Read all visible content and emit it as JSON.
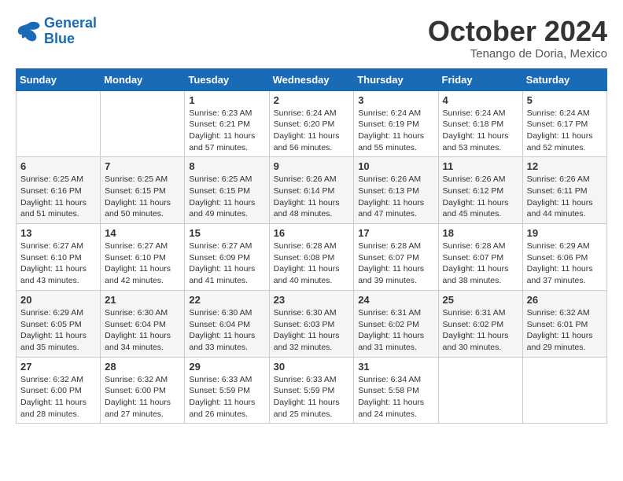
{
  "logo": {
    "line1": "General",
    "line2": "Blue"
  },
  "title": "October 2024",
  "subtitle": "Tenango de Doria, Mexico",
  "days_of_week": [
    "Sunday",
    "Monday",
    "Tuesday",
    "Wednesday",
    "Thursday",
    "Friday",
    "Saturday"
  ],
  "weeks": [
    [
      {
        "num": "",
        "info": ""
      },
      {
        "num": "",
        "info": ""
      },
      {
        "num": "1",
        "info": "Sunrise: 6:23 AM\nSunset: 6:21 PM\nDaylight: 11 hours and 57 minutes."
      },
      {
        "num": "2",
        "info": "Sunrise: 6:24 AM\nSunset: 6:20 PM\nDaylight: 11 hours and 56 minutes."
      },
      {
        "num": "3",
        "info": "Sunrise: 6:24 AM\nSunset: 6:19 PM\nDaylight: 11 hours and 55 minutes."
      },
      {
        "num": "4",
        "info": "Sunrise: 6:24 AM\nSunset: 6:18 PM\nDaylight: 11 hours and 53 minutes."
      },
      {
        "num": "5",
        "info": "Sunrise: 6:24 AM\nSunset: 6:17 PM\nDaylight: 11 hours and 52 minutes."
      }
    ],
    [
      {
        "num": "6",
        "info": "Sunrise: 6:25 AM\nSunset: 6:16 PM\nDaylight: 11 hours and 51 minutes."
      },
      {
        "num": "7",
        "info": "Sunrise: 6:25 AM\nSunset: 6:15 PM\nDaylight: 11 hours and 50 minutes."
      },
      {
        "num": "8",
        "info": "Sunrise: 6:25 AM\nSunset: 6:15 PM\nDaylight: 11 hours and 49 minutes."
      },
      {
        "num": "9",
        "info": "Sunrise: 6:26 AM\nSunset: 6:14 PM\nDaylight: 11 hours and 48 minutes."
      },
      {
        "num": "10",
        "info": "Sunrise: 6:26 AM\nSunset: 6:13 PM\nDaylight: 11 hours and 47 minutes."
      },
      {
        "num": "11",
        "info": "Sunrise: 6:26 AM\nSunset: 6:12 PM\nDaylight: 11 hours and 45 minutes."
      },
      {
        "num": "12",
        "info": "Sunrise: 6:26 AM\nSunset: 6:11 PM\nDaylight: 11 hours and 44 minutes."
      }
    ],
    [
      {
        "num": "13",
        "info": "Sunrise: 6:27 AM\nSunset: 6:10 PM\nDaylight: 11 hours and 43 minutes."
      },
      {
        "num": "14",
        "info": "Sunrise: 6:27 AM\nSunset: 6:10 PM\nDaylight: 11 hours and 42 minutes."
      },
      {
        "num": "15",
        "info": "Sunrise: 6:27 AM\nSunset: 6:09 PM\nDaylight: 11 hours and 41 minutes."
      },
      {
        "num": "16",
        "info": "Sunrise: 6:28 AM\nSunset: 6:08 PM\nDaylight: 11 hours and 40 minutes."
      },
      {
        "num": "17",
        "info": "Sunrise: 6:28 AM\nSunset: 6:07 PM\nDaylight: 11 hours and 39 minutes."
      },
      {
        "num": "18",
        "info": "Sunrise: 6:28 AM\nSunset: 6:07 PM\nDaylight: 11 hours and 38 minutes."
      },
      {
        "num": "19",
        "info": "Sunrise: 6:29 AM\nSunset: 6:06 PM\nDaylight: 11 hours and 37 minutes."
      }
    ],
    [
      {
        "num": "20",
        "info": "Sunrise: 6:29 AM\nSunset: 6:05 PM\nDaylight: 11 hours and 35 minutes."
      },
      {
        "num": "21",
        "info": "Sunrise: 6:30 AM\nSunset: 6:04 PM\nDaylight: 11 hours and 34 minutes."
      },
      {
        "num": "22",
        "info": "Sunrise: 6:30 AM\nSunset: 6:04 PM\nDaylight: 11 hours and 33 minutes."
      },
      {
        "num": "23",
        "info": "Sunrise: 6:30 AM\nSunset: 6:03 PM\nDaylight: 11 hours and 32 minutes."
      },
      {
        "num": "24",
        "info": "Sunrise: 6:31 AM\nSunset: 6:02 PM\nDaylight: 11 hours and 31 minutes."
      },
      {
        "num": "25",
        "info": "Sunrise: 6:31 AM\nSunset: 6:02 PM\nDaylight: 11 hours and 30 minutes."
      },
      {
        "num": "26",
        "info": "Sunrise: 6:32 AM\nSunset: 6:01 PM\nDaylight: 11 hours and 29 minutes."
      }
    ],
    [
      {
        "num": "27",
        "info": "Sunrise: 6:32 AM\nSunset: 6:00 PM\nDaylight: 11 hours and 28 minutes."
      },
      {
        "num": "28",
        "info": "Sunrise: 6:32 AM\nSunset: 6:00 PM\nDaylight: 11 hours and 27 minutes."
      },
      {
        "num": "29",
        "info": "Sunrise: 6:33 AM\nSunset: 5:59 PM\nDaylight: 11 hours and 26 minutes."
      },
      {
        "num": "30",
        "info": "Sunrise: 6:33 AM\nSunset: 5:59 PM\nDaylight: 11 hours and 25 minutes."
      },
      {
        "num": "31",
        "info": "Sunrise: 6:34 AM\nSunset: 5:58 PM\nDaylight: 11 hours and 24 minutes."
      },
      {
        "num": "",
        "info": ""
      },
      {
        "num": "",
        "info": ""
      }
    ]
  ]
}
